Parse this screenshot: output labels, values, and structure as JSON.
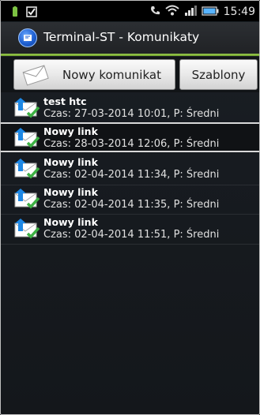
{
  "status_bar": {
    "time": "15:49",
    "icons": [
      "battery-small-icon",
      "checkbox-notification-icon",
      "phone-signal-icon",
      "wifi-icon",
      "cellular-signal-icon",
      "battery-icon"
    ]
  },
  "header": {
    "title": "Terminal-ST - Komunikaty",
    "icon": "app-logo-icon",
    "accent_color": "#8bc34a"
  },
  "toolbar": {
    "new_label": "Nowy komunikat",
    "templates_label": "Szablony",
    "new_icon": "envelope-icon"
  },
  "messages": [
    {
      "title": "test htc",
      "meta": "Czas: 27-03-2014 10:01, P: Średni",
      "selected": false
    },
    {
      "title": "Nowy link",
      "meta": "Czas: 28-03-2014 12:06, P: Średni",
      "selected": true
    },
    {
      "title": "Nowy link",
      "meta": "Czas: 02-04-2014 11:34, P: Średni",
      "selected": false
    },
    {
      "title": "Nowy link",
      "meta": "Czas: 02-04-2014 11:35, P: Średni",
      "selected": false
    },
    {
      "title": "Nowy link",
      "meta": "Czas: 02-04-2014 11:51, P: Średni",
      "selected": false
    }
  ]
}
